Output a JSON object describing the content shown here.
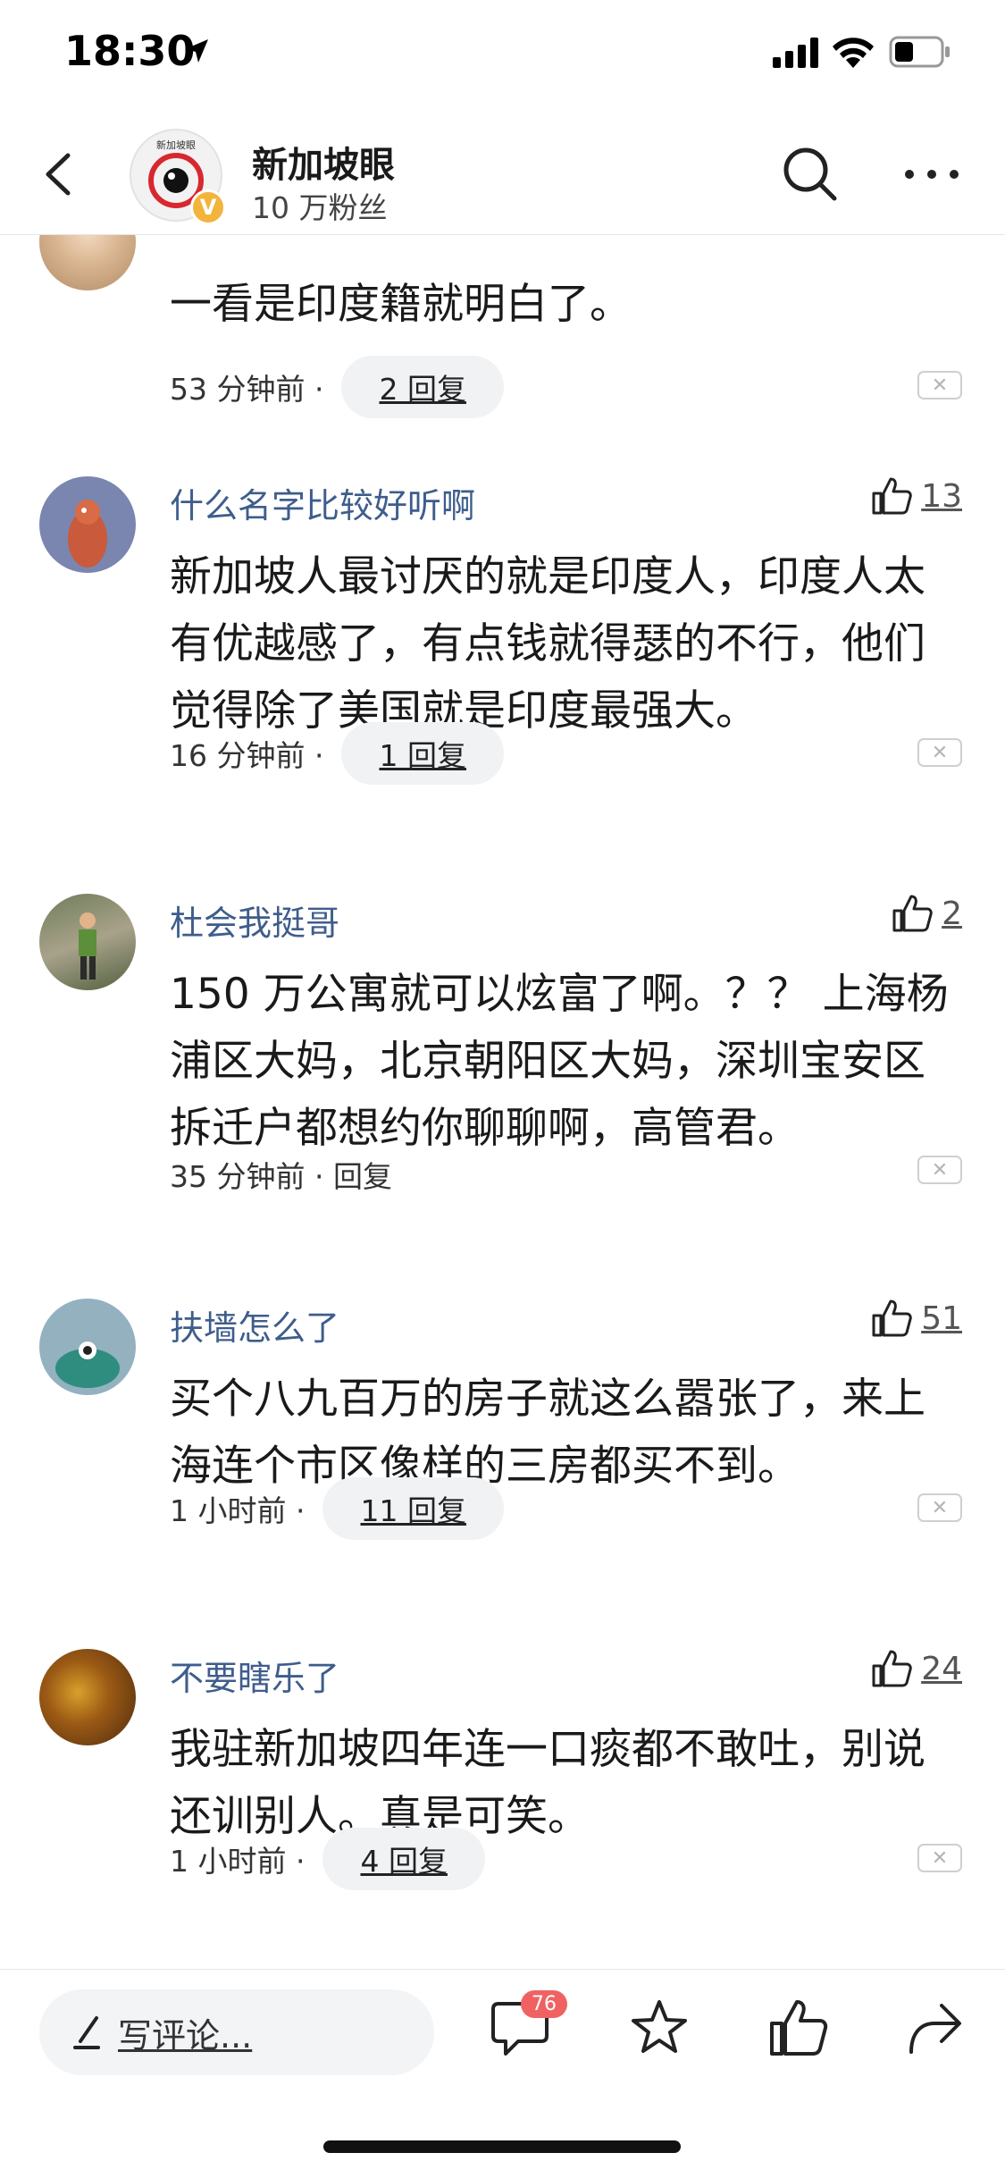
{
  "status_bar": {
    "time": "18:30"
  },
  "header": {
    "account_name": "新加坡眼",
    "followers": "10 万粉丝",
    "verified_badge": "V",
    "logo_text": "新加坡眼"
  },
  "comments": [
    {
      "username": "",
      "text": "一看是印度籍就明白了。",
      "time": "53 分钟前 ·",
      "reply": "2 回复",
      "likes": ""
    },
    {
      "username": "什么名字比较好听啊",
      "text": "新加坡人最讨厌的就是印度人，印度人太有优越感了，有点钱就得瑟的不行，他们觉得除了美国就是印度最强大。",
      "time": "16 分钟前 ·",
      "reply": "1 回复",
      "likes": "13"
    },
    {
      "username": "杜会我挺哥",
      "text": "150 万公寓就可以炫富了啊。？？ 上海杨浦区大妈，北京朝阳区大妈，深圳宝安区拆迁户都想约你聊聊啊，高管君。",
      "time": "35 分钟前 · 回复",
      "reply": "",
      "likes": "2"
    },
    {
      "username": "扶墙怎么了",
      "text": "买个八九百万的房子就这么嚣张了，来上海连个市区像样的三房都买不到。",
      "time": "1 小时前 ·",
      "reply": "11 回复",
      "likes": "51"
    },
    {
      "username": "不要瞎乐了",
      "text": "我驻新加坡四年连一口痰都不敢吐，别说还训别人。真是可笑。",
      "time": "1 小时前 ·",
      "reply": "4 回复",
      "likes": "24"
    }
  ],
  "bottom_bar": {
    "write_placeholder": "写评论...",
    "comment_count": "76"
  }
}
